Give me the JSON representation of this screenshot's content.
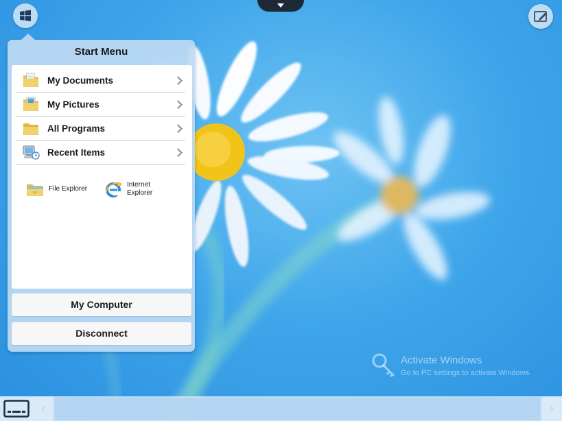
{
  "start_menu": {
    "title": "Start Menu",
    "items": [
      {
        "label": "My Documents",
        "icon": "documents-folder-icon"
      },
      {
        "label": "My Pictures",
        "icon": "pictures-folder-icon"
      },
      {
        "label": "All Programs",
        "icon": "programs-folder-icon"
      },
      {
        "label": "Recent Items",
        "icon": "recent-items-icon"
      }
    ],
    "tiles": [
      {
        "label": "File Explorer",
        "icon": "file-explorer-icon"
      },
      {
        "label": "Internet Explorer",
        "icon": "internet-explorer-icon"
      }
    ],
    "my_computer_label": "My Computer",
    "disconnect_label": "Disconnect"
  },
  "watermark": {
    "title": "Activate Windows",
    "subtitle": "Go to PC settings to activate Windows."
  },
  "colors": {
    "desktop_blue": "#3fa6ea",
    "panel_blue": "#bcd9f3",
    "flower_center": "#f2c318"
  }
}
